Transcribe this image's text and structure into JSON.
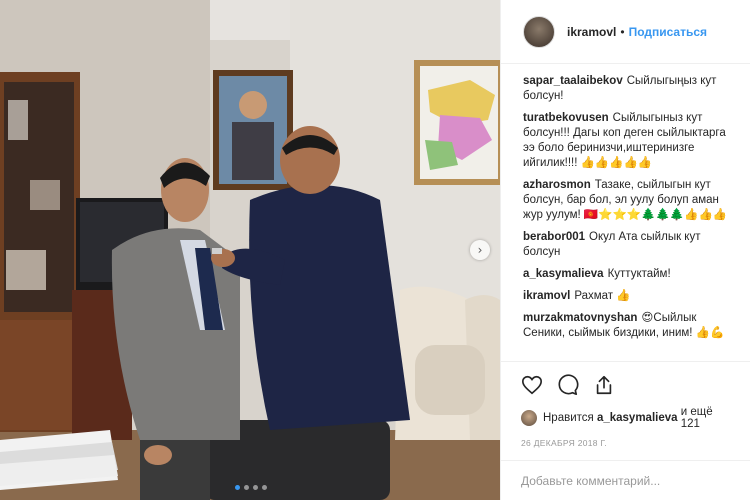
{
  "post": {
    "username": "ikramovl",
    "separator": "•",
    "follow_label": "Подписаться"
  },
  "photo": {
    "nav_arrow": "›",
    "dots_count": 4,
    "active_dot": 0
  },
  "comments": [
    {
      "author": "sapar_taalaibekov",
      "text": "Сыйлыгыңыз кут болсун!"
    },
    {
      "author": "turatbekovusen",
      "text": "Сыйлыгыныз кут болсун!!! Дагы коп деген сыйлыктарга ээ боло беринизчи,иштеринизге ийгилик!!!! 👍👍👍👍👍"
    },
    {
      "author": "azharosmon",
      "text": "Тазаке, сыйлыгын кут болсун, бар бол, эл уулу болуп аман жур уулум! 🇰🇬⭐⭐⭐🌲🌲🌲👍👍👍"
    },
    {
      "author": "berabor001",
      "text": "Окул Ата сыйлык кут болсун"
    },
    {
      "author": "a_kasymalieva",
      "text": "Куттуктайм!"
    },
    {
      "author": "ikramovl",
      "text": "Рахмат 👍"
    },
    {
      "author": "murzakmatovnyshan",
      "text": "😍Сыйлык Сеники, сыймык биздики, иним! 👍💪"
    }
  ],
  "actions": {
    "likes_prefix": "Нравится",
    "likes_user": "a_kasymalieva",
    "likes_suffix": "и ещё 121",
    "date": "26 ДЕКАБРЯ 2018 Г.",
    "comment_placeholder": "Добавьте комментарий..."
  },
  "icons": [
    "heart-icon",
    "comment-icon",
    "share-icon",
    "chevron-right-icon"
  ],
  "colors": {
    "accent": "#3897f0",
    "text": "#262626",
    "muted": "#999999",
    "border": "#efefef"
  }
}
